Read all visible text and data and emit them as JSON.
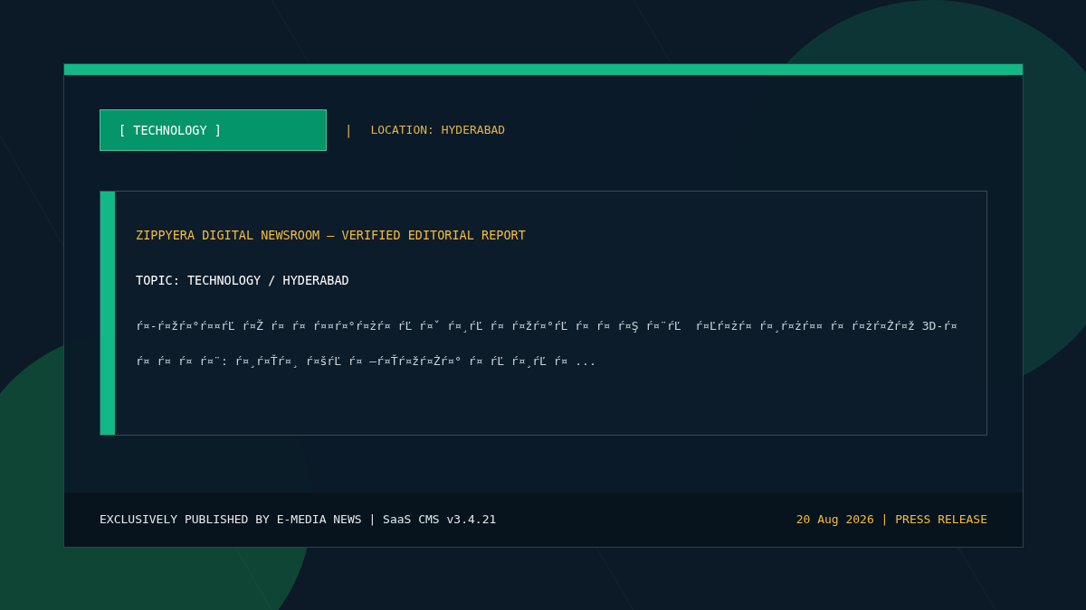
{
  "tag": {
    "label": "[ TECHNOLOGY ]"
  },
  "separator": "|",
  "location": "LOCATION: HYDERABAD",
  "report": {
    "title": "ZIPPYERA DIGITAL NEWSROOM — VERIFIED EDITORIAL REPORT",
    "topic": "TOPIC: TECHNOLOGY / HYDERABAD",
    "body_lines": [
      "ŕ¤-ŕ¤žŕ¤°ŕ¤¤ŕĽ ŕ¤Ž ŕ¤ ŕ¤ ŕ¤¤ŕ¤°ŕ¤żŕ¤ ŕĽ ŕ¤ˇ ŕ¤¸ŕĽ ŕ¤ ŕ¤žŕ¤°ŕĽ ŕ¤ ŕ¤ ŕ¤Ş ŕ¤¨ŕĽ  ŕ¤Ľŕ¤żŕ¤ ŕ¤¸ŕ¤żŕ¤¤ ŕ¤ ŕ¤żŕ¤Żŕ¤ž 3D-ŕ¤",
      "ŕ¤ ŕ¤ ŕ¤ ŕ¤¨: ŕ¤¸ŕ¤Ťŕ¤¸ ŕ¤šŕĽ ŕ¤ –ŕ¤Ťŕ¤žŕ¤Żŕ¤° ŕ¤ ŕĽ ŕ¤¸ŕĽ ŕ¤ ..."
    ]
  },
  "footer": {
    "publisher": "EXCLUSIVELY PUBLISHED BY E-MEDIA NEWS | SaaS CMS v3.4.21",
    "date": "20 Aug 2026 | PRESS RELEASE"
  }
}
